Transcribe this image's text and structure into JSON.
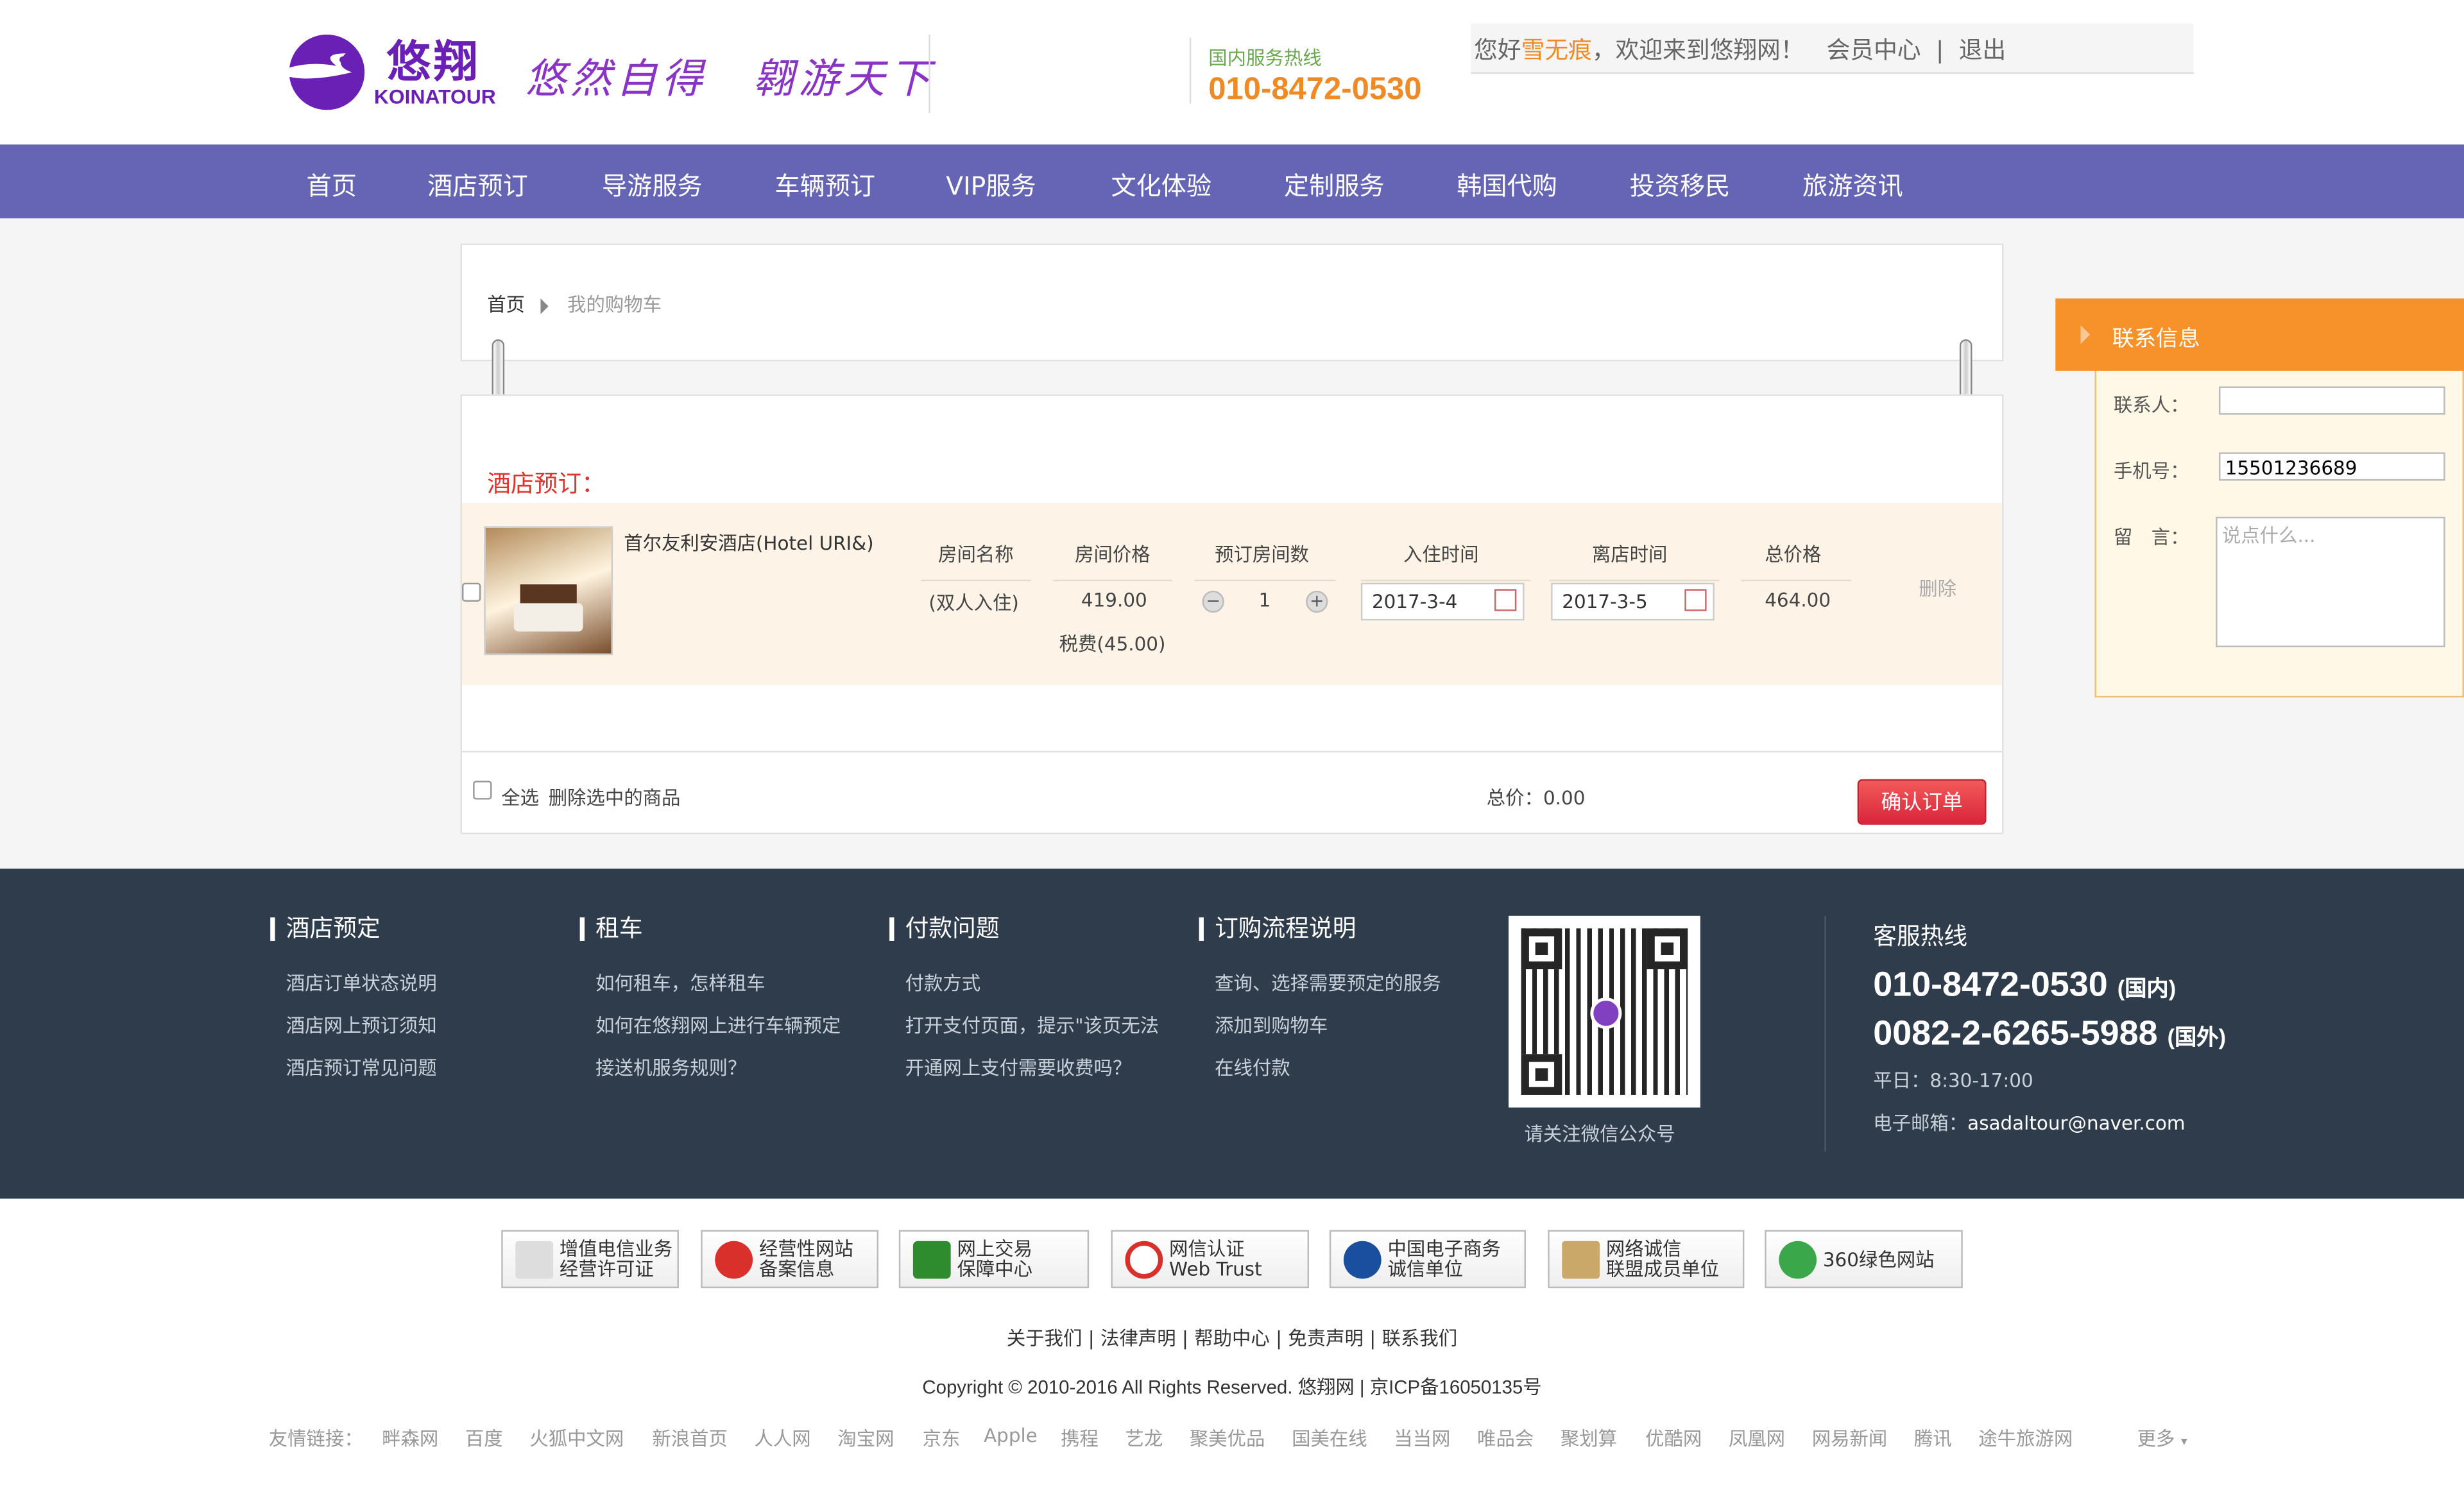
{
  "header": {
    "logo_cn": "悠翔",
    "logo_en": "KOINATOUR",
    "slogan": "悠然自得　翱游天下",
    "hotline_label": "国内服务热线",
    "hotline_number": "010-8472-0530",
    "welcome_prefix": "您好",
    "username": "雪无痕",
    "welcome_suffix": "，欢迎来到悠翔网！",
    "member_center": "会员中心",
    "divider": "|",
    "logout": "退出"
  },
  "nav": {
    "items": [
      "首页",
      "酒店预订",
      "导游服务",
      "车辆预订",
      "VIP服务",
      "文化体验",
      "定制服务",
      "韩国代购",
      "投资移民",
      "旅游资讯"
    ]
  },
  "breadcrumb": {
    "home": "首页",
    "current": "我的购物车"
  },
  "cart": {
    "section_title": "酒店预订：",
    "hotel_name": "首尔友利安酒店(Hotel URI&)",
    "columns": {
      "room_name": "房间名称",
      "room_price": "房间价格",
      "room_count": "预订房间数",
      "checkin": "入住时间",
      "checkout": "离店时间",
      "total": "总价格"
    },
    "room_type": "(双人入住)",
    "price": "419.00",
    "tax": "税费(45.00)",
    "quantity": "1",
    "checkin_date": "2017-3-4",
    "checkout_date": "2017-3-5",
    "total_price": "464.00",
    "delete": "删除",
    "select_all": "全选",
    "delete_selected": "删除选中的商品",
    "grand_total_label": "总价：",
    "grand_total": "0.00",
    "confirm": "确认订单"
  },
  "contact": {
    "title": "联系信息",
    "name_label": "联系人：",
    "name_value": "",
    "phone_label": "手机号：",
    "phone_value": "15501236689",
    "message_label": "留　言：",
    "message_placeholder": "说点什么..."
  },
  "footer": {
    "cols": [
      {
        "title": "酒店预定",
        "links": [
          "酒店订单状态说明",
          "酒店网上预订须知",
          "酒店预订常见问题"
        ]
      },
      {
        "title": "租车",
        "links": [
          "如何租车，怎样租车",
          "如何在悠翔网上进行车辆预定",
          "接送机服务规则？"
        ]
      },
      {
        "title": "付款问题",
        "links": [
          "付款方式",
          "打开支付页面，提示\"该页无法",
          "开通网上支付需要收费吗？"
        ]
      },
      {
        "title": "订购流程说明",
        "links": [
          "查询、选择需要预定的服务",
          "添加到购物车",
          "在线付款"
        ]
      }
    ],
    "qr_caption": "请关注微信公众号",
    "hotline_title": "客服热线",
    "hotline_domestic": "010-8472-0530",
    "hotline_domestic_tag": "(国内)",
    "hotline_intl": "0082-2-6265-5988",
    "hotline_intl_tag": "(国外)",
    "hours": "平日：8:30-17:00",
    "email_label": "电子邮箱：",
    "email": "asadaltour@naver.com"
  },
  "badges": [
    {
      "l1": "增值电信业务",
      "l2": "经营许可证"
    },
    {
      "l1": "经营性网站",
      "l2": "备案信息"
    },
    {
      "l1": "网上交易",
      "l2": "保障中心"
    },
    {
      "l1": "网信认证",
      "l2": "Web Trust"
    },
    {
      "l1": "中国电子商务",
      "l2": "诚信单位"
    },
    {
      "l1": "网络诚信",
      "l2": "联盟成员单位"
    },
    {
      "l1": "360绿色网站",
      "l2": ""
    }
  ],
  "bottom_links": [
    "关于我们",
    "法律声明",
    "帮助中心",
    "免责声明",
    "联系我们"
  ],
  "copyright": "Copyright © 2010-2016 All Rights Reserved. 悠翔网 | 京ICP备16050135号",
  "friend_label": "友情链接：",
  "friend_links": [
    "畔森网",
    "百度",
    "火狐中文网",
    "新浪首页",
    "人人网",
    "淘宝网",
    "京东",
    "Apple",
    "携程",
    "艺龙",
    "聚美优品",
    "国美在线",
    "当当网",
    "唯品会",
    "聚划算",
    "优酷网",
    "凤凰网",
    "网易新闻",
    "腾讯",
    "途牛旅游网"
  ],
  "more": "更多"
}
